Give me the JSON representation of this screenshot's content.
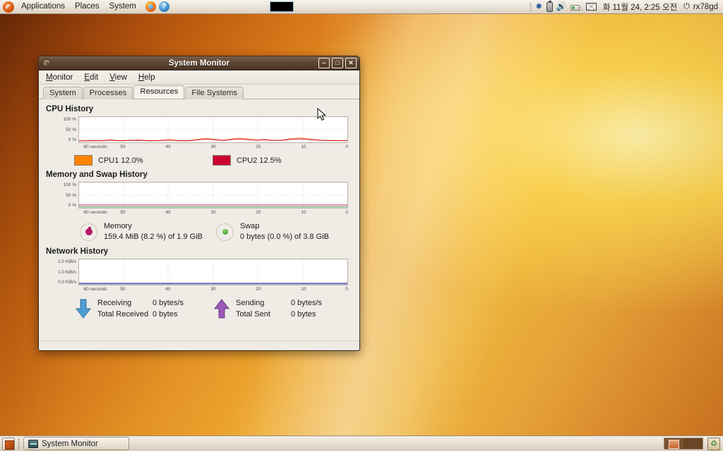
{
  "top_panel": {
    "logo_icon": "ubuntu-logo-icon",
    "menus": [
      "Applications",
      "Places",
      "System"
    ],
    "launchers": [
      {
        "icon": "firefox-icon",
        "label": ""
      },
      {
        "icon": "help-icon",
        "label": "?"
      }
    ],
    "tray": {
      "grip": "panel-grip",
      "bluetooth_icon": "bluetooth-icon",
      "battery_icon": "battery-icon",
      "volume_icon": "volume-icon",
      "network_icon": "network-icon",
      "mail_icon": "mail-icon",
      "clock": "화 11월 24,  2:25 오전",
      "power_icon": "power-icon",
      "user": "rx78gd"
    }
  },
  "window": {
    "title": "System Monitor",
    "icon": "system-monitor-icon",
    "buttons": {
      "minimize": "–",
      "maximize": "□",
      "close": "✕"
    },
    "menubar": [
      "Monitor",
      "Edit",
      "View",
      "Help"
    ],
    "tabs": [
      {
        "label": "System",
        "active": false
      },
      {
        "label": "Processes",
        "active": false
      },
      {
        "label": "Resources",
        "active": true
      },
      {
        "label": "File Systems",
        "active": false
      }
    ]
  },
  "cpu": {
    "title": "CPU History",
    "y_labels": [
      "100 %",
      "50 %",
      "0 %"
    ],
    "x_labels": [
      "60 seconds",
      "50",
      "40",
      "30",
      "20",
      "10",
      "0"
    ],
    "legend": [
      {
        "name": "CPU1",
        "value": "12.0%",
        "color": "#ff8400"
      },
      {
        "name": "CPU2",
        "value": "12.5%",
        "color": "#cc0033"
      }
    ]
  },
  "memory": {
    "title": "Memory and Swap History",
    "y_labels": [
      "100 %",
      "50 %",
      "0 %"
    ],
    "x_labels": [
      "60 seconds",
      "50",
      "40",
      "30",
      "20",
      "10",
      "0"
    ],
    "items": [
      {
        "icon": "memory-pie-icon",
        "name": "Memory",
        "value": "159.4 MiB (8.2 %) of 1.9 GiB",
        "color": "#b5196b"
      },
      {
        "icon": "swap-pie-icon",
        "name": "Swap",
        "value": "0 bytes (0.0 %) of 3.8 GiB",
        "color": "#3f9a3f"
      }
    ]
  },
  "network": {
    "title": "Network History",
    "y_labels": [
      "2.0 KiB/s",
      "1.0 KiB/s",
      "0.0 KiB/s"
    ],
    "x_labels": [
      "60 seconds",
      "50",
      "40",
      "30",
      "20",
      "10",
      "0"
    ],
    "items": [
      {
        "icon": "download-arrow-icon",
        "color": "#3a8ec7",
        "rate_label": "Receiving",
        "rate_value": "0 bytes/s",
        "total_label": "Total Received",
        "total_value": "0 bytes"
      },
      {
        "icon": "upload-arrow-icon",
        "color": "#8e44ad",
        "rate_label": "Sending",
        "rate_value": "0 bytes/s",
        "total_label": "Total Sent",
        "total_value": "0 bytes"
      }
    ]
  },
  "bottom_panel": {
    "show_desktop_icon": "show-desktop-icon",
    "tasks": [
      {
        "icon": "system-monitor-icon",
        "label": "System Monitor"
      }
    ],
    "workspaces": [
      {
        "active": true
      },
      {
        "active": false
      }
    ],
    "trash_icon": "trash-icon"
  },
  "chart_data": [
    {
      "type": "line",
      "title": "CPU History",
      "xlabel": "seconds",
      "ylabel": "%",
      "ylim": [
        0,
        100
      ],
      "xlim": [
        60,
        0
      ],
      "grid": true,
      "legend": "below",
      "x": [
        60,
        58,
        56,
        54,
        52,
        50,
        48,
        46,
        44,
        42,
        40,
        38,
        36,
        34,
        32,
        30,
        28,
        26,
        24,
        22,
        20,
        18,
        16,
        14,
        12,
        10,
        8,
        6,
        4,
        2,
        0
      ],
      "series": [
        {
          "name": "CPU1",
          "color": "#ff8400",
          "current": 12.0,
          "values": [
            2,
            2,
            3,
            2,
            4,
            3,
            2,
            5,
            3,
            2,
            3,
            2,
            4,
            3,
            6,
            3,
            2,
            8,
            9,
            6,
            3,
            10,
            7,
            3,
            2,
            5,
            9,
            4,
            3,
            2,
            3
          ]
        },
        {
          "name": "CPU2",
          "color": "#cc0033",
          "current": 12.5,
          "values": [
            3,
            2,
            4,
            3,
            3,
            2,
            3,
            4,
            2,
            3,
            2,
            3,
            3,
            2,
            5,
            4,
            3,
            7,
            8,
            5,
            4,
            9,
            6,
            2,
            3,
            4,
            8,
            3,
            2,
            3,
            2
          ]
        }
      ]
    },
    {
      "type": "line",
      "title": "Memory and Swap History",
      "xlabel": "seconds",
      "ylabel": "%",
      "ylim": [
        0,
        100
      ],
      "xlim": [
        60,
        0
      ],
      "grid": true,
      "legend": "below",
      "x": [
        60,
        50,
        40,
        30,
        20,
        10,
        0
      ],
      "series": [
        {
          "name": "Memory",
          "color": "#b5196b",
          "current": 8.2,
          "values": [
            8.2,
            8.2,
            8.2,
            8.2,
            8.2,
            8.2,
            8.2
          ]
        },
        {
          "name": "Swap",
          "color": "#3f9a3f",
          "current": 0.0,
          "values": [
            0,
            0,
            0,
            0,
            0,
            0,
            0
          ]
        }
      ]
    },
    {
      "type": "line",
      "title": "Network History",
      "xlabel": "seconds",
      "ylabel": "KiB/s",
      "ylim": [
        0,
        2.0
      ],
      "xlim": [
        60,
        0
      ],
      "grid": true,
      "legend": "below",
      "x": [
        60,
        50,
        40,
        30,
        20,
        10,
        0
      ],
      "series": [
        {
          "name": "Receiving",
          "color": "#3a8ec7",
          "current": 0,
          "values": [
            0,
            0,
            0,
            0,
            0,
            0,
            0
          ]
        },
        {
          "name": "Sending",
          "color": "#8e44ad",
          "current": 0,
          "values": [
            0,
            0,
            0,
            0,
            0,
            0,
            0
          ]
        }
      ]
    }
  ]
}
